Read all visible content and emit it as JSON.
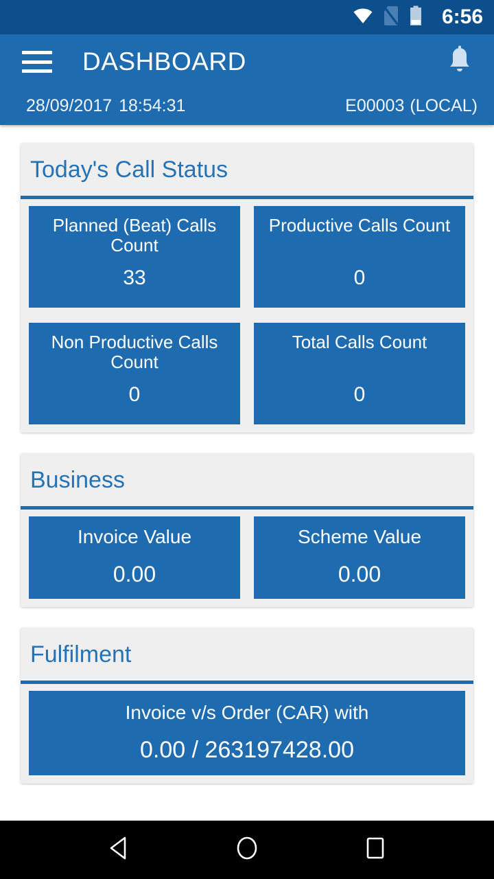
{
  "status_bar": {
    "time": "6:56",
    "icons": [
      "wifi-icon",
      "no-sim-icon",
      "battery-icon"
    ],
    "background": "#0d4e8c"
  },
  "app_bar": {
    "menu_icon": "hamburger-menu-icon",
    "title": "DASHBOARD",
    "notification_icon": "bell-icon",
    "date": "28/09/2017",
    "time": "18:54:31",
    "user_code": "E00003",
    "user_mode": "(LOCAL)",
    "background": "#1f6bb0"
  },
  "theme": {
    "accent": "#1f6bb0",
    "card_background": "#efefef",
    "title_color": "#2573b5",
    "tile_text": "#ffffff",
    "page_background": "#ffffff",
    "nav_background": "#000000"
  },
  "cards": [
    {
      "title": "Today's Call Status",
      "rows": [
        [
          {
            "label": "Planned (Beat) Calls Count",
            "value": "33"
          },
          {
            "label": "Productive Calls Count",
            "value": "0"
          }
        ],
        [
          {
            "label": "Non Productive Calls Count",
            "value": "0"
          },
          {
            "label": "Total Calls Count",
            "value": "0"
          }
        ]
      ]
    },
    {
      "title": "Business",
      "rows": [
        [
          {
            "label": "Invoice Value",
            "value": "0.00"
          },
          {
            "label": "Scheme Value",
            "value": "0.00"
          }
        ]
      ]
    },
    {
      "title": "Fulfilment",
      "rows": [
        [
          {
            "label": "Invoice v/s Order (CAR) with",
            "value": "0.00 / 263197428.00"
          }
        ]
      ]
    }
  ],
  "nav_bar": {
    "back_label": "back-button",
    "home_label": "home-button",
    "recents_label": "recents-button"
  }
}
